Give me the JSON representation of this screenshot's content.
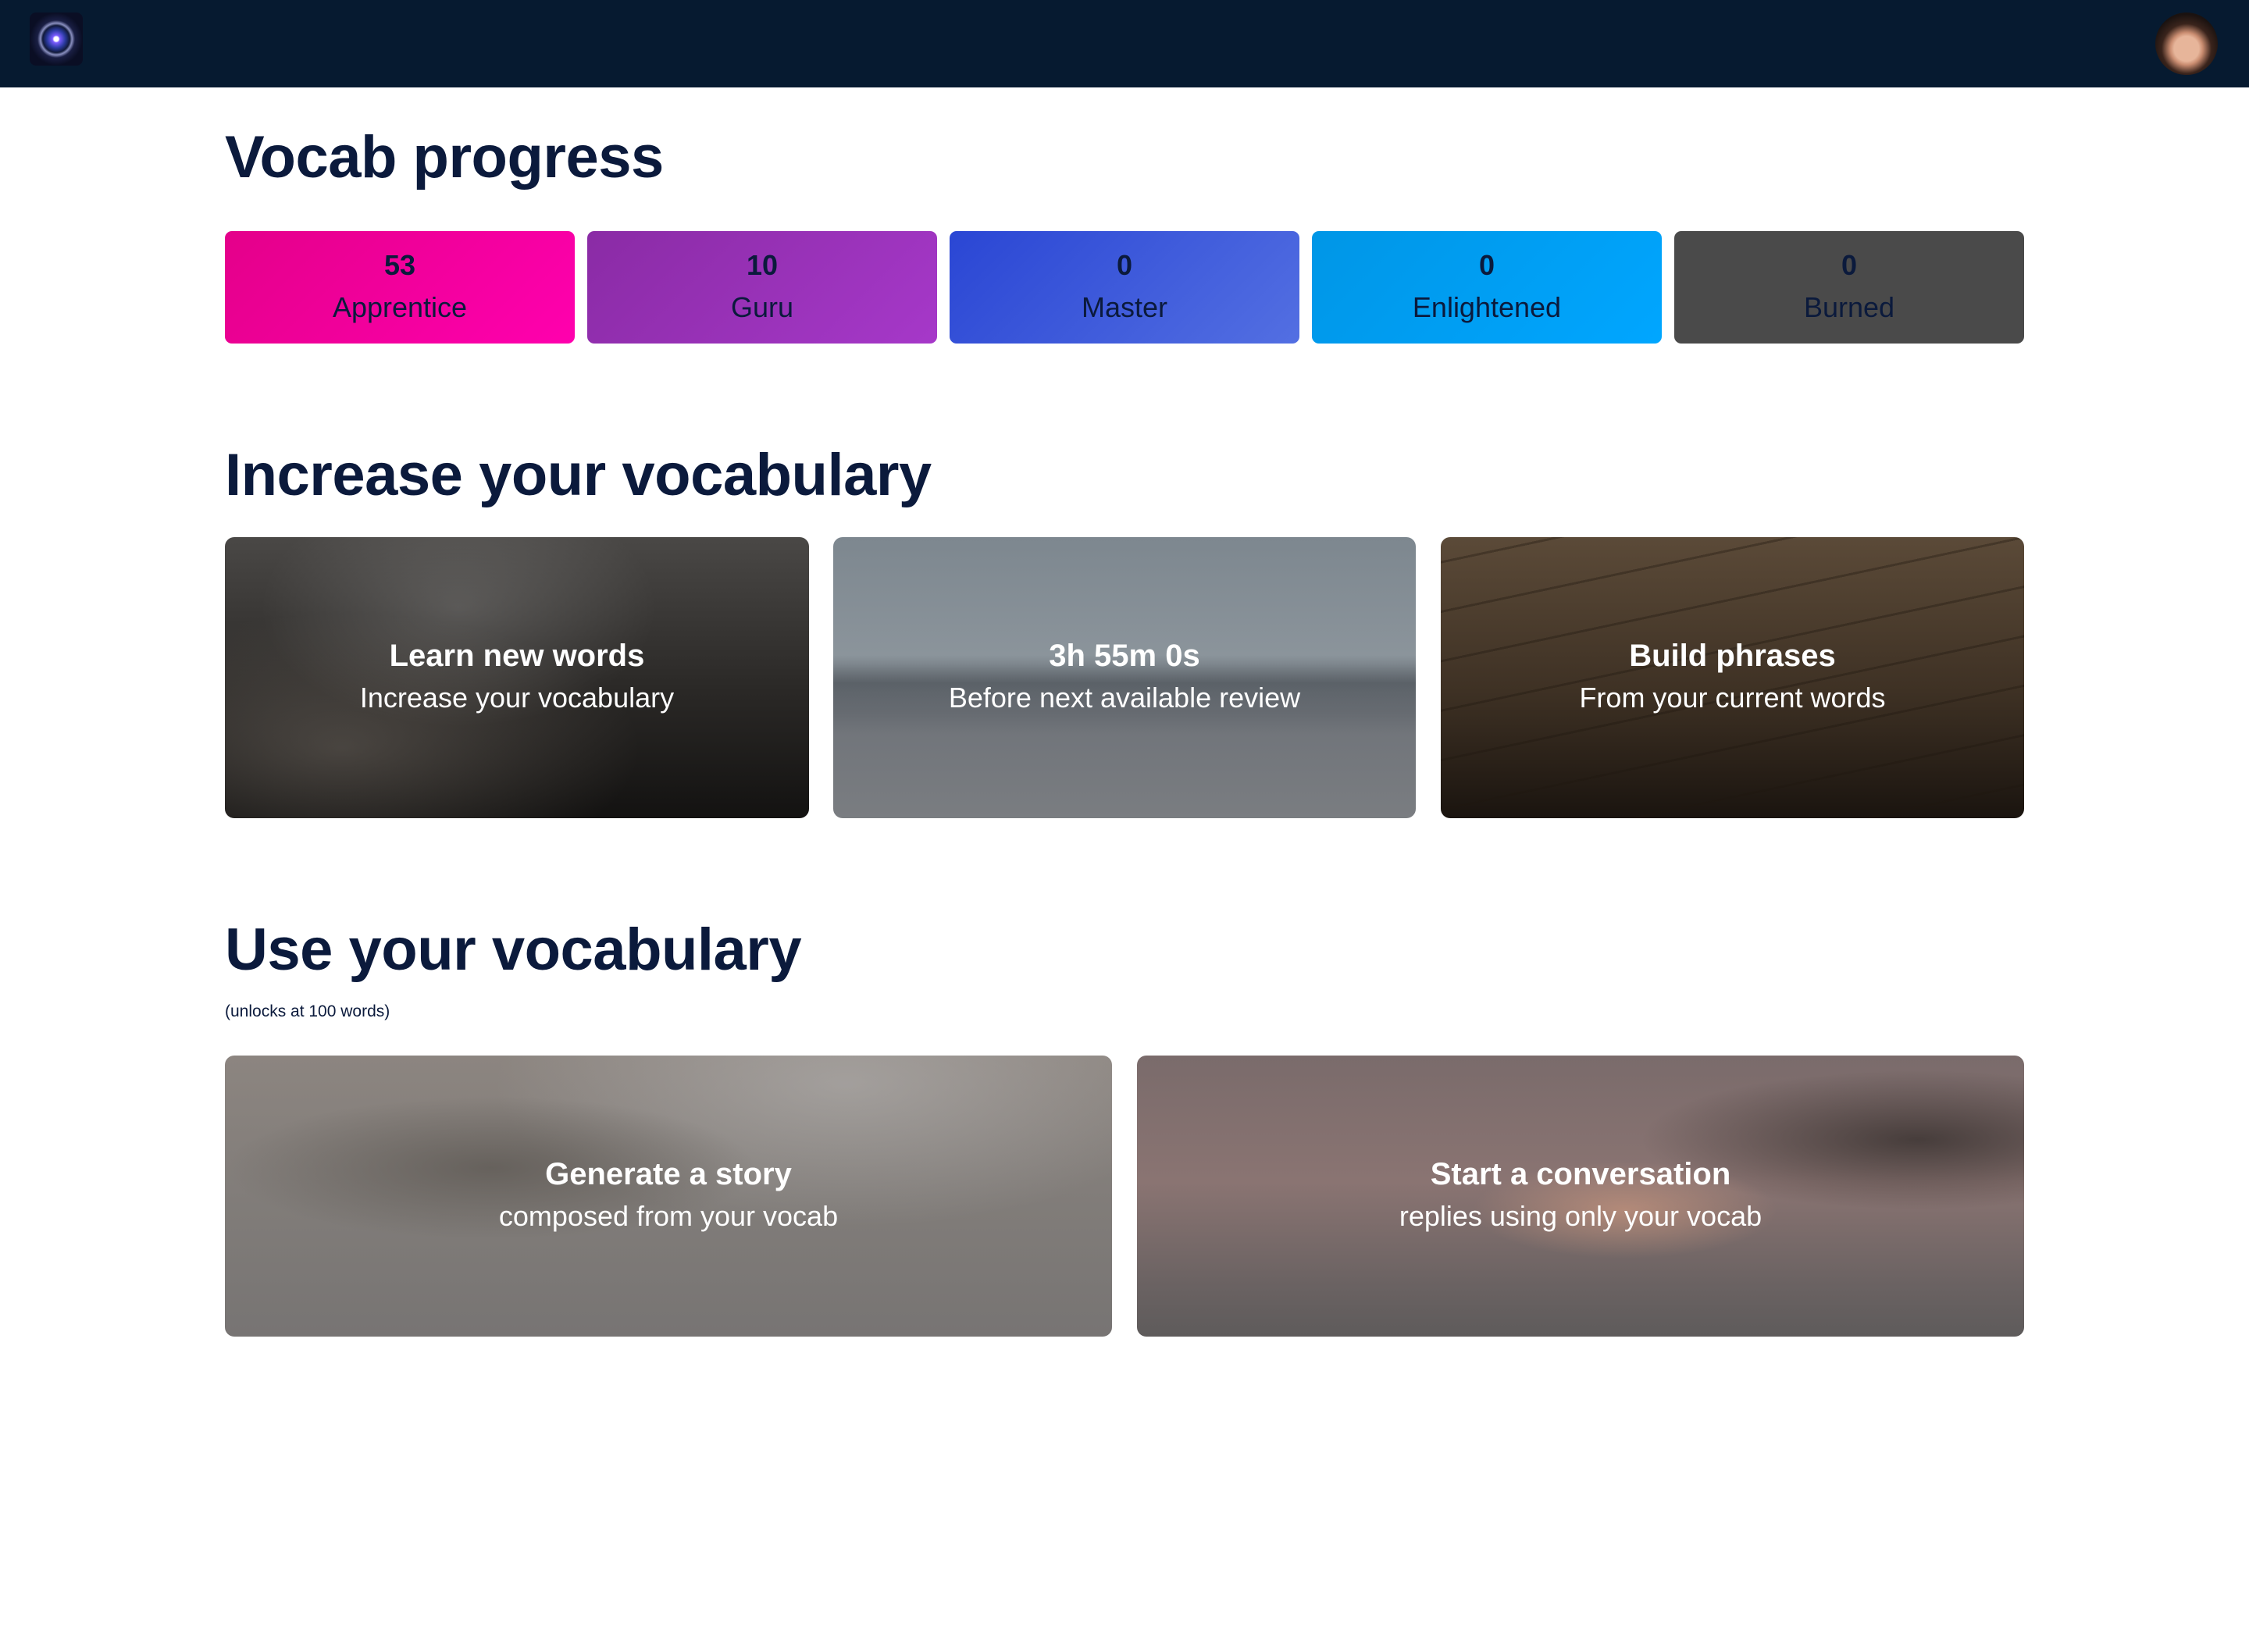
{
  "header": {
    "logo_icon": "galaxy-logo-icon",
    "avatar_icon": "user-avatar-icon"
  },
  "progress": {
    "title": "Vocab progress",
    "stages": [
      {
        "count": "53",
        "label": "Apprentice",
        "color": "#f000a0"
      },
      {
        "count": "10",
        "label": "Guru",
        "color": "#9a33b8"
      },
      {
        "count": "0",
        "label": "Master",
        "color": "#3c5adc"
      },
      {
        "count": "0",
        "label": "Enlightened",
        "color": "#009ff2"
      },
      {
        "count": "0",
        "label": "Burned",
        "color": "#4a4a4a"
      }
    ]
  },
  "increase": {
    "title": "Increase your vocabulary",
    "cards": [
      {
        "title": "Learn new words",
        "subtitle": "Increase your vocabulary"
      },
      {
        "title": "3h 55m 0s",
        "subtitle": "Before next available review"
      },
      {
        "title": "Build phrases",
        "subtitle": "From your current words"
      }
    ]
  },
  "use": {
    "title": "Use your vocabulary",
    "note": "(unlocks at 100 words)",
    "cards": [
      {
        "title": "Generate a story",
        "subtitle": "composed from your vocab"
      },
      {
        "title": "Start a conversation",
        "subtitle": "replies using only your vocab"
      }
    ]
  }
}
